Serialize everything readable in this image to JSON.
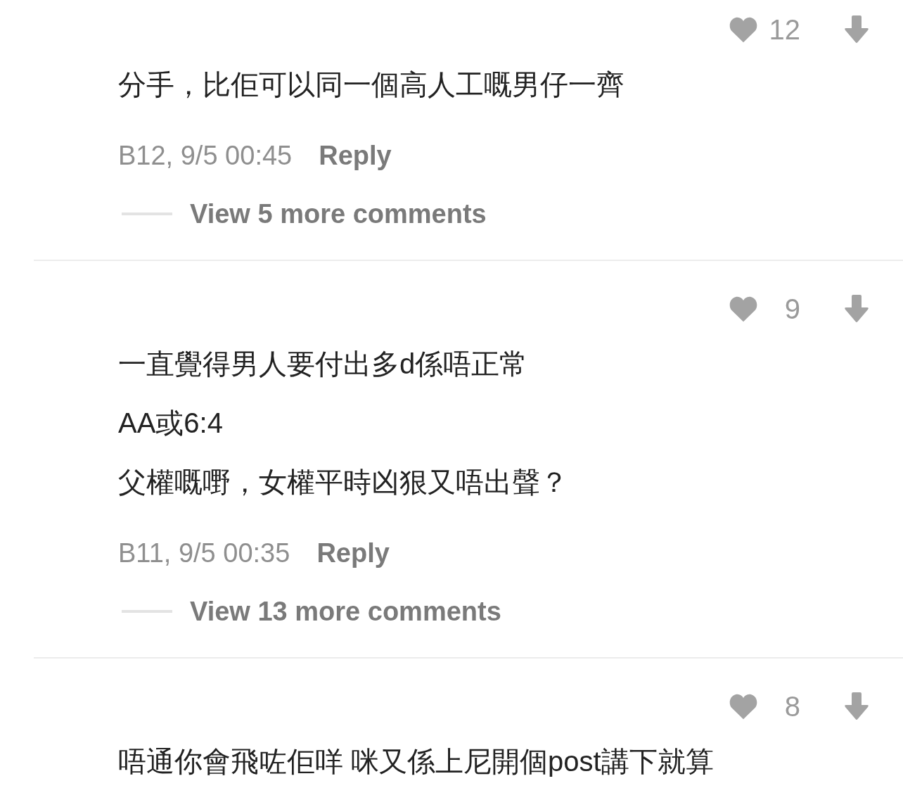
{
  "comments": [
    {
      "likes": "12",
      "lines": [
        "分手，比佢可以同一個高人工嘅男仔一齊"
      ],
      "meta": "B12, 9/5 00:45",
      "reply": "Reply",
      "view_more": "View 5 more comments"
    },
    {
      "likes": "9",
      "lines": [
        "一直覺得男人要付出多d係唔正常",
        "AA或6:4",
        "父權嘅嘢，女權平時凶狠又唔出聲？"
      ],
      "meta": "B11, 9/5 00:35",
      "reply": "Reply",
      "view_more": "View 13 more comments"
    },
    {
      "likes": "8",
      "lines": [
        "唔通你會飛咗佢咩 咪又係上尼開個post講下就算"
      ]
    }
  ]
}
